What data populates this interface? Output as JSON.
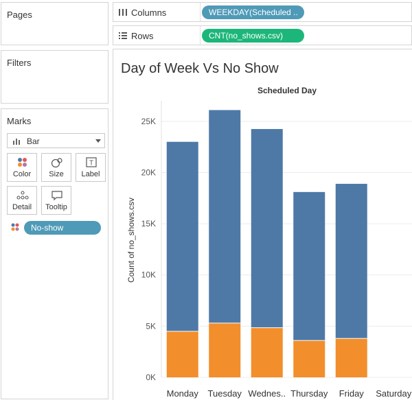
{
  "panels": {
    "pages_title": "Pages",
    "filters_title": "Filters",
    "marks_title": "Marks"
  },
  "marks": {
    "type_label": "Bar",
    "buttons": {
      "color": "Color",
      "size": "Size",
      "label": "Label",
      "detail": "Detail",
      "tooltip": "Tooltip"
    },
    "color_field": "No-show"
  },
  "shelves": {
    "columns_label": "Columns",
    "columns_pill": "WEEKDAY(Scheduled ..",
    "rows_label": "Rows",
    "rows_pill": "CNT(no_shows.csv)"
  },
  "colors": {
    "teal_pill": "#4f9ab7",
    "green_pill": "#1db67a",
    "blue_bar": "#4e79a7",
    "orange_bar": "#f28e2b"
  },
  "chart_data": {
    "type": "bar",
    "title": "Day of Week Vs No Show",
    "column_header": "Scheduled Day",
    "ylabel": "Count of no_shows.csv",
    "categories": [
      "Monday",
      "Tuesday",
      "Wednes..",
      "Thursday",
      "Friday",
      "Saturday"
    ],
    "series": [
      {
        "color": "#f28e2b",
        "values": [
          4500,
          5300,
          4850,
          3600,
          3800,
          0
        ]
      },
      {
        "color": "#4e79a7",
        "values": [
          18500,
          20800,
          19400,
          14500,
          15100,
          0
        ]
      }
    ],
    "totals": [
      23000,
      26100,
      24250,
      18100,
      18900,
      0
    ],
    "yticks": [
      0,
      5000,
      10000,
      15000,
      20000,
      25000
    ],
    "ytick_labels": [
      "0K",
      "5K",
      "10K",
      "15K",
      "20K",
      "25K"
    ],
    "ylim": [
      0,
      27000
    ],
    "stacked": true,
    "grid": true
  }
}
